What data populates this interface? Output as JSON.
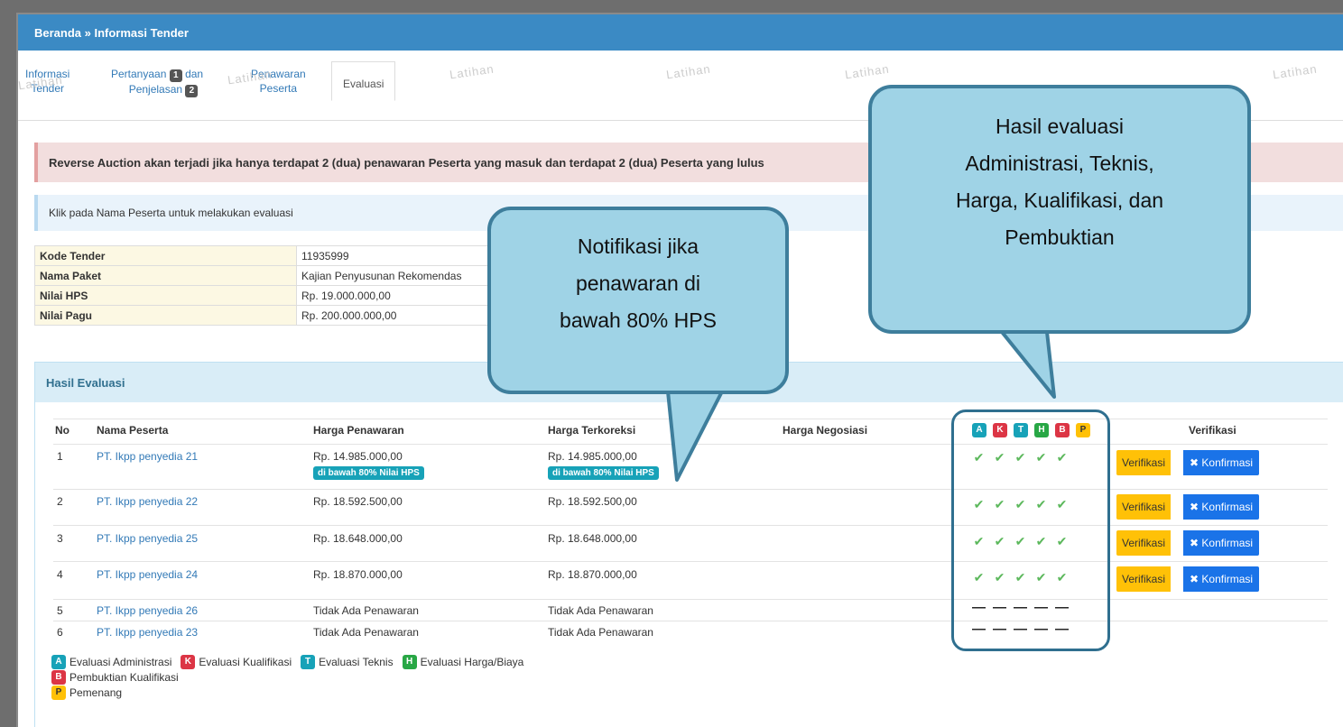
{
  "breadcrumb": "Beranda » Informasi Tender",
  "tabs": {
    "informasi_1": "Informasi",
    "informasi_2": "Tender",
    "pertanyaan_1": "Pertanyaan",
    "pertanyaan_num1": "1",
    "pertanyaan_dan": "dan",
    "pertanyaan_2": "Penjelasan",
    "pertanyaan_num2": "2",
    "penawaran_1": "Penawaran",
    "penawaran_2": "Peserta",
    "evaluasi": "Evaluasi"
  },
  "watermark": "Latihan",
  "alert_reverse": "Reverse Auction akan terjadi jika hanya terdapat 2 (dua) penawaran Peserta yang masuk dan terdapat 2 (dua) Peserta yang lulus",
  "alert_klik": "Klik pada Nama Peserta untuk melakukan evaluasi",
  "info": [
    {
      "label": "Kode Tender",
      "value": "11935999"
    },
    {
      "label": "Nama Paket",
      "value": "Kajian Penyusunan Rekomendas"
    },
    {
      "label": "Nilai HPS",
      "value": "Rp. 19.000.000,00"
    },
    {
      "label": "Nilai Pagu",
      "value": "Rp. 200.000.000,00"
    }
  ],
  "panel_title": "Hasil Evaluasi",
  "table": {
    "headers": {
      "no": "No",
      "nama": "Nama Peserta",
      "penawaran": "Harga Penawaran",
      "terkoreksi": "Harga Terkoreksi",
      "negosiasi": "Harga Negosiasi",
      "verifikasi": "Verifikasi"
    },
    "eval_letters": [
      "A",
      "K",
      "T",
      "H",
      "B",
      "P"
    ],
    "below_hps_badge": "di bawah 80% Nilai HPS",
    "rows": [
      {
        "no": "1",
        "nama": "PT. Ikpp penyedia 21",
        "penawaran": "Rp. 14.985.000,00",
        "terkoreksi": "Rp. 14.985.000,00"
      },
      {
        "no": "2",
        "nama": "PT. Ikpp penyedia 22",
        "penawaran": "Rp. 18.592.500,00",
        "terkoreksi": "Rp. 18.592.500,00"
      },
      {
        "no": "3",
        "nama": "PT. Ikpp penyedia 25",
        "penawaran": "Rp. 18.648.000,00",
        "terkoreksi": "Rp. 18.648.000,00"
      },
      {
        "no": "4",
        "nama": "PT. Ikpp penyedia 24",
        "penawaran": "Rp. 18.870.000,00",
        "terkoreksi": "Rp. 18.870.000,00"
      },
      {
        "no": "5",
        "nama": "PT. Ikpp penyedia 26",
        "penawaran": "Tidak Ada Penawaran",
        "terkoreksi": "Tidak Ada Penawaran"
      },
      {
        "no": "6",
        "nama": "PT. Ikpp penyedia 23",
        "penawaran": "Tidak Ada Penawaran",
        "terkoreksi": "Tidak Ada Penawaran"
      }
    ],
    "btn_verifikasi": "Verifikasi",
    "btn_konfirmasi": "✖ Konfirmasi"
  },
  "legend": {
    "a": "Evaluasi Administrasi",
    "k": "Evaluasi Kualifikasi",
    "t": "Evaluasi Teknis",
    "h": "Evaluasi Harga/Biaya",
    "b": "Pembuktian Kualifikasi",
    "p": "Pemenang"
  },
  "callouts": {
    "notif": [
      "Notifikasi jika",
      "penawaran di",
      "bawah 80% HPS"
    ],
    "hasil": [
      "Hasil evaluasi",
      "Administrasi, Teknis,",
      "Harga, Kualifikasi, dan",
      "Pembuktian"
    ]
  },
  "colors": {
    "header": "#3b8ac4",
    "teal": "#17a2b8",
    "red": "#dc3545",
    "green": "#28a745",
    "yellow": "#ffc107",
    "blue_btn": "#1a73e8",
    "callout": "#9fd3e6"
  }
}
